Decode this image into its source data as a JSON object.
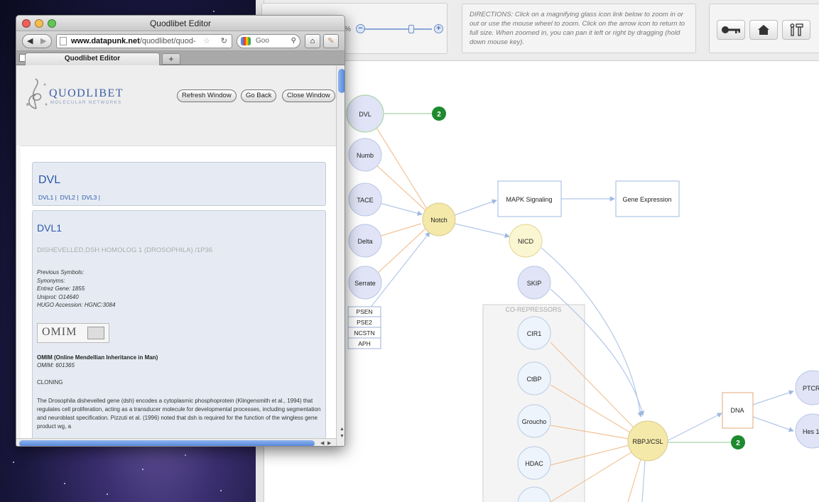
{
  "browser": {
    "window_title": "Quodlibet Editor",
    "url_domain": "www.datapunk.net",
    "url_path": "/quodlibet/quod-",
    "search_placeholder": "Goo",
    "tab_label": "Quodlibet Editor",
    "new_tab": "+"
  },
  "page": {
    "logo_text": "QUODLIBET",
    "logo_sub": "MOLECULAR NETWORKS",
    "buttons": {
      "refresh": "Refresh Window",
      "back": "Go Back",
      "close": "Close Window"
    },
    "gene_group": {
      "title": "DVL",
      "links": [
        "DVL1",
        "DVL2",
        "DVL3"
      ]
    },
    "gene": {
      "title": "DVL1",
      "full_name": "DISHEVELLED,DSH HOMOLOG 1 (DROSOPHILA) /1P36",
      "previous_symbols": "Previous Symbols:",
      "synonyms": "Synonyms:",
      "entrez": "Entrez Gene: 1855",
      "uniprot": "Uniprot: O14640",
      "hugo": "HUGO Accession: HGNC:3084",
      "omim_logo": "OMIM",
      "omim_heading": "OMIM (Online Mendellian Inheritance in Man)",
      "omim_number": "OMIM: 601365",
      "section": "CLONING",
      "body": "The Drosophila dishevelled gene (dsh) encodes a cytoplasmic phosphoprotein (Klingensmith et al., 1994) that regulates cell proliferation, acting as a transducer molecule for developmental processes, including segmentation and neuroblast specification. Pizzuti et al. (1996) noted that dsh is required for the function of the wingless gene product wg, a"
    }
  },
  "toolbar": {
    "zoom_percent": "%",
    "directions": "DIRECTIONS: Click on a magnifying glass icon link below to zoom in or out or use the mouse wheel to zoom. Click on the arrow icon to return to full size. When zoomed in, you can pan it left or right by dragging (hold down mouse key).",
    "tool_icons": [
      "key-icon",
      "home-icon",
      "tools-icon"
    ]
  },
  "network": {
    "nodes": {
      "dvl": "DVL",
      "numb": "Numb",
      "tace": "TACE",
      "delta": "Delta",
      "serrate": "Serrate",
      "notch": "Notch",
      "nicd": "NICD",
      "skip": "SKIP",
      "cir1": "CIR1",
      "cibp": "CtBP",
      "groucho": "Groucho",
      "hdac": "HDAC",
      "rbpj": "RBPJ/CSL",
      "ptcr": "PTCR",
      "hes": "Hes 1"
    },
    "gamma_secretase": [
      "PSEN",
      "PSE2",
      "NCSTN",
      "APH"
    ],
    "boxes": {
      "mapk": "MAPK Signaling",
      "gene_expression": "Gene Expression",
      "dna": "DNA"
    },
    "corepressors_label": "CO-REPRESSORS",
    "badges": {
      "dvl_count": "2",
      "rbpj_count": "2"
    },
    "colors": {
      "node_blue": "#e0e4f6",
      "node_yellow": "#f4e9a9",
      "node_pale": "#eef4fb",
      "edge_orange": "#f2c49a",
      "edge_blue": "#b3c8e8",
      "badge_green": "#1d8a2f"
    }
  }
}
